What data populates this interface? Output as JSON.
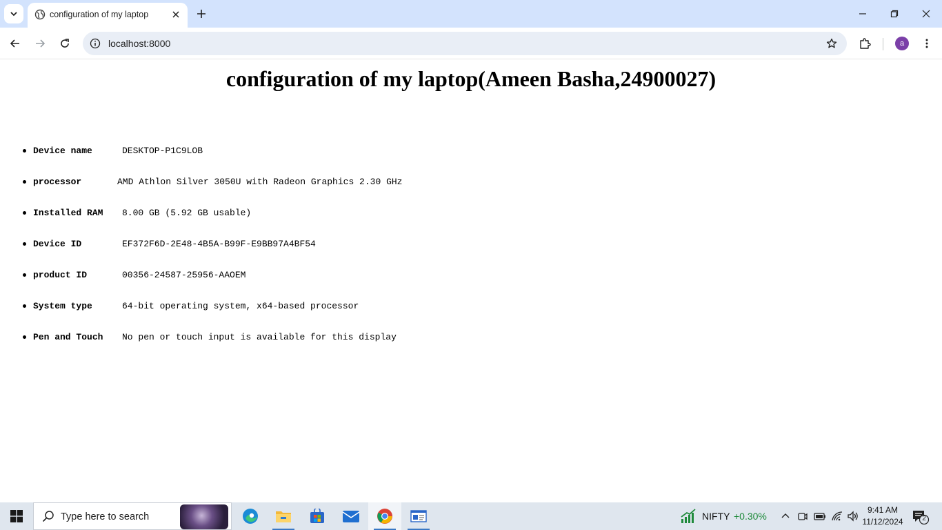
{
  "browser": {
    "tab_title": "configuration of my laptop",
    "url": "localhost:8000",
    "profile_initial": "a"
  },
  "page": {
    "heading": "configuration of my laptop(Ameen Basha,24900027)",
    "specs": [
      {
        "label": "Device name",
        "value": "DESKTOP-P1C9LOB"
      },
      {
        "label": "processor",
        "value": "AMD Athlon Silver 3050U with Radeon Graphics 2.30 GHz"
      },
      {
        "label": "Installed RAM",
        "value": "8.00 GB (5.92 GB usable)"
      },
      {
        "label": "Device ID",
        "value": "EF372F6D-2E48-4B5A-B99F-E9BB97A4BF54"
      },
      {
        "label": "product ID",
        "value": "00356-24587-25956-AAOEM"
      },
      {
        "label": "System type",
        "value": "64-bit operating system, x64-based processor"
      },
      {
        "label": "Pen and Touch",
        "value": "No pen or touch input is available for this display"
      }
    ]
  },
  "taskbar": {
    "search_placeholder": "Type here to search",
    "stock_name": "NIFTY",
    "stock_change": "+0.30%",
    "time": "9:41 AM",
    "date": "11/12/2024",
    "notification_count": "2"
  },
  "colors": {
    "tab_strip": "#d3e3fd",
    "omnibox": "#e9eef6",
    "avatar": "#7b3fa8",
    "stock_positive": "#1e8a3a",
    "taskbar": "#dfe6ee"
  }
}
